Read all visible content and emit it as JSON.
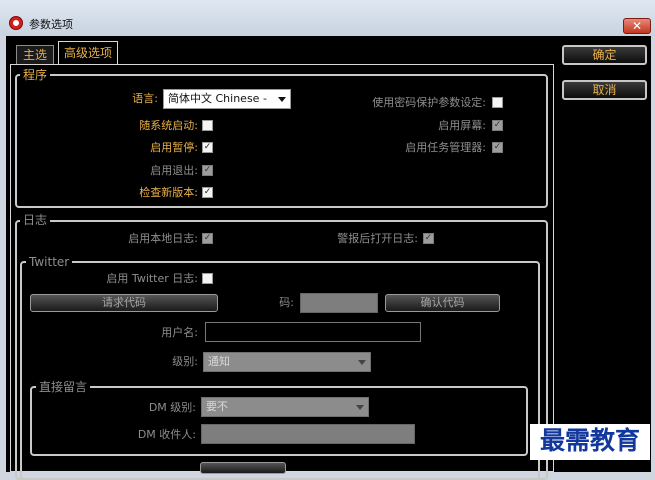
{
  "window": {
    "title": "参数选项",
    "close_glyph": "✕"
  },
  "tabs": [
    {
      "label": "主选"
    },
    {
      "label": "高级选项"
    }
  ],
  "buttons": {
    "ok": "确定",
    "cancel": "取消"
  },
  "program": {
    "legend": "程序",
    "language_label": "语言:",
    "language_value": "简体中文 Chinese -",
    "autostart_label": "随系统启动:",
    "pause_label": "启用暂停:",
    "exit_label": "启用退出:",
    "check_update_label": "检查新版本:",
    "password_label": "使用密码保护参数设定:",
    "screen_label": "启用屏幕:",
    "task_manager_label": "启用任务管理器:"
  },
  "log": {
    "legend": "日志",
    "local_log_label": "启用本地日志:",
    "alert_log_label": "警报后打开日志:",
    "twitter": {
      "legend": "Twitter",
      "enable_label": "启用 Twitter 日志:",
      "request_code_button": "请求代码",
      "code_label": "码:",
      "confirm_code_button": "确认代码",
      "username_label": "用户名:",
      "level_label": "级别:",
      "level_value": "通知",
      "direct": {
        "legend": "直接留言",
        "dm_level_label": "DM 级别:",
        "dm_level_value": "要不",
        "dm_recipient_label": "DM 收件人:"
      }
    }
  },
  "watermark": "最需教育",
  "checkboxes": {
    "autostart": "",
    "pause": "✓",
    "exit": "✓",
    "check_update": "✓",
    "password": "",
    "screen": "✓",
    "task_manager": "✓",
    "local_log": "✓",
    "alert_log": "✓",
    "twitter_enable": ""
  }
}
